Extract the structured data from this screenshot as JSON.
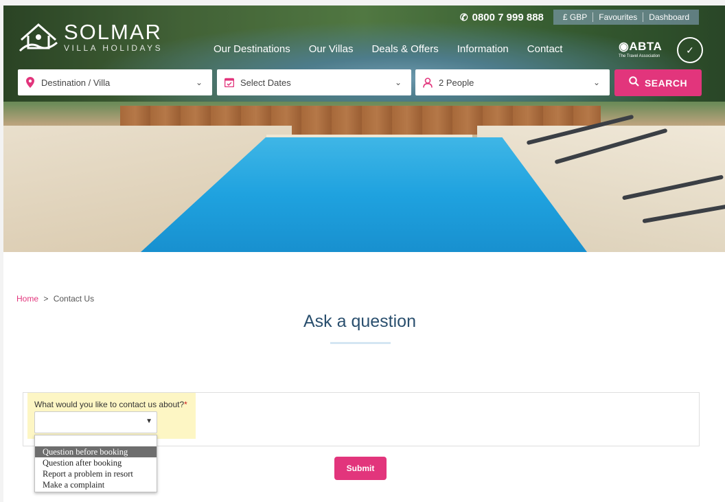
{
  "header": {
    "brand_name": "SOLMAR",
    "brand_sub": "VILLA HOLIDAYS",
    "phone": "0800 7 999 888",
    "utility": [
      "£ GBP",
      "Favourites",
      "Dashboard"
    ],
    "nav": [
      "Our Destinations",
      "Our Villas",
      "Deals & Offers",
      "Information",
      "Contact"
    ],
    "abta_name": "ABTA",
    "abta_sub": "The Travel Association"
  },
  "search": {
    "destination": "Destination / Villa",
    "dates": "Select Dates",
    "people": "2 People",
    "button": "SEARCH"
  },
  "breadcrumb": {
    "home": "Home",
    "separator": ">",
    "current": "Contact Us"
  },
  "page_title": "Ask a question",
  "form": {
    "label": "What would you like to contact us about?",
    "required_mark": "*",
    "selected_value": "",
    "options": [
      "Question before booking",
      "Question after booking",
      "Report a problem in resort",
      "Make a complaint"
    ],
    "highlighted_option_index": 0,
    "submit": "Submit"
  },
  "colors": {
    "accent": "#e2357c",
    "title": "#2a4f6e",
    "field_highlight": "#fdf6c4"
  },
  "icons": [
    "phone-icon",
    "location-pin-icon",
    "calendar-icon",
    "person-icon",
    "chevron-down-icon",
    "search-icon",
    "logo-house-icon",
    "abta-globe-icon"
  ]
}
